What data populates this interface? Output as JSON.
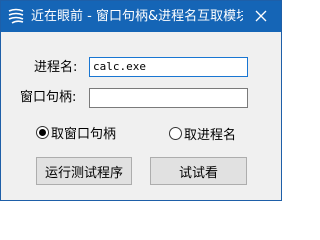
{
  "window": {
    "title": "近在眼前 - 窗口句柄&进程名互取模块...",
    "icon": "app-logo-icon",
    "close_icon": "close-icon",
    "accent_color": "#1565b6"
  },
  "form": {
    "process_label": "进程名:",
    "process_value": "calc.exe",
    "handle_label": "窗口句柄:",
    "handle_value": ""
  },
  "options": {
    "get_handle_label": "取窗口句柄",
    "get_handle_selected": true,
    "get_process_label": "取进程名",
    "get_process_selected": false
  },
  "buttons": {
    "run_test_label": "运行测试程序",
    "try_label": "试试看"
  }
}
